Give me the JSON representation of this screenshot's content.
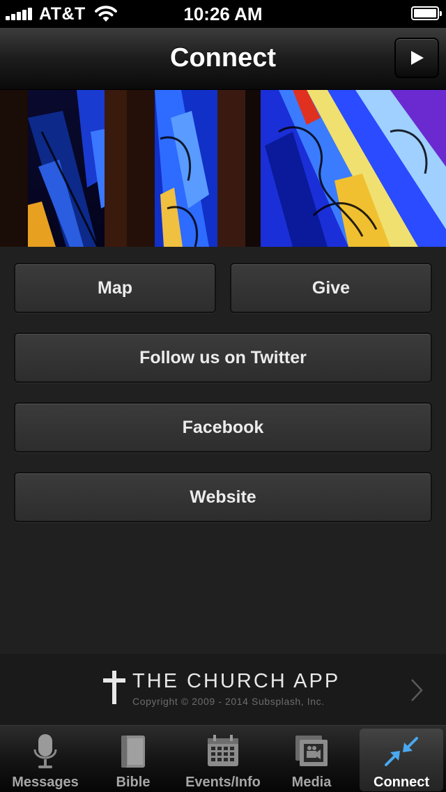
{
  "status_bar": {
    "carrier": "AT&T",
    "time": "10:26 AM"
  },
  "nav": {
    "title": "Connect",
    "action_icon": "play-icon"
  },
  "hero": {
    "image_icon": "stained-glass-image"
  },
  "buttons": {
    "map": "Map",
    "give": "Give",
    "twitter": "Follow us on Twitter",
    "facebook": "Facebook",
    "website": "Website"
  },
  "footer": {
    "brand": "THE CHURCH APP",
    "copyright": "Copyright © 2009 - 2014 Subsplash, Inc."
  },
  "tabs": [
    {
      "label": "Messages",
      "icon": "microphone-icon",
      "selected": false
    },
    {
      "label": "Bible",
      "icon": "book-icon",
      "selected": false
    },
    {
      "label": "Events/Info",
      "icon": "calendar-icon",
      "selected": false
    },
    {
      "label": "Media",
      "icon": "film-icon",
      "selected": false
    },
    {
      "label": "Connect",
      "icon": "connect-arrows-icon",
      "selected": true
    }
  ],
  "colors": {
    "background": "#202020",
    "button": "#333333",
    "selected_tab_icon": "#4aa8f0"
  }
}
